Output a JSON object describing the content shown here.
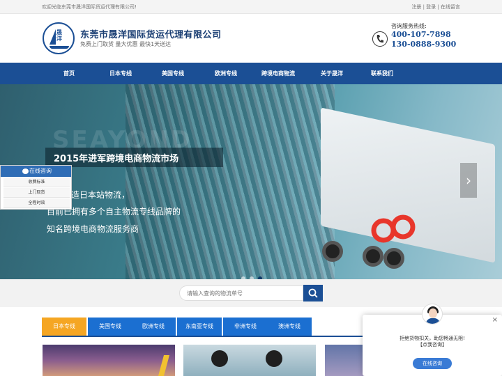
{
  "topbar": {
    "welcome": "欢迎光临东莞市晟洋国际货运代理有限公司!",
    "register": "注册",
    "login": "登录",
    "message": "在线留言",
    "sep": "|"
  },
  "header": {
    "logo_text": "晟洋",
    "company_name": "东莞市晟洋国际货运代理有限公司",
    "slogan": "免费上门取货 量大优惠 最快1天送达",
    "hotline_label": "咨询服务热线:",
    "hotline_1": "400-107-7898",
    "hotline_2": "130-0888-9300"
  },
  "nav": {
    "items": [
      "首页",
      "日本专线",
      "美国专线",
      "欧洲专线",
      "跨境电商物流",
      "关于晟洋",
      "联系我们"
    ]
  },
  "banner": {
    "watermark": "SEAYOND",
    "title": "2015年进军跨境电商物流市场",
    "line1": "造日本站物流，",
    "line2": "目前已拥有多个自主物流专线品牌的",
    "line3": "知名跨境电商物流服务商",
    "next_arrow": "›"
  },
  "float_widget": {
    "title": "在线咨询",
    "items": [
      "收费标准",
      "上门取货",
      "全程时效"
    ]
  },
  "search": {
    "placeholder": "请输入查询的物流单号"
  },
  "tabs": {
    "items": [
      "日本专线",
      "美国专线",
      "欧洲专线",
      "东南亚专线",
      "非洲专线",
      "澳洲专线"
    ],
    "active": "日本专线"
  },
  "chat_popup": {
    "message": "拒绝货物扣关，助您畅通无阻!",
    "sub": "【点我咨询】",
    "button": "在线咨询",
    "close": "×"
  },
  "colors": {
    "brand_blue": "#1b4f95",
    "tab_blue": "#1b6fd1",
    "tab_active": "#f5a623"
  }
}
